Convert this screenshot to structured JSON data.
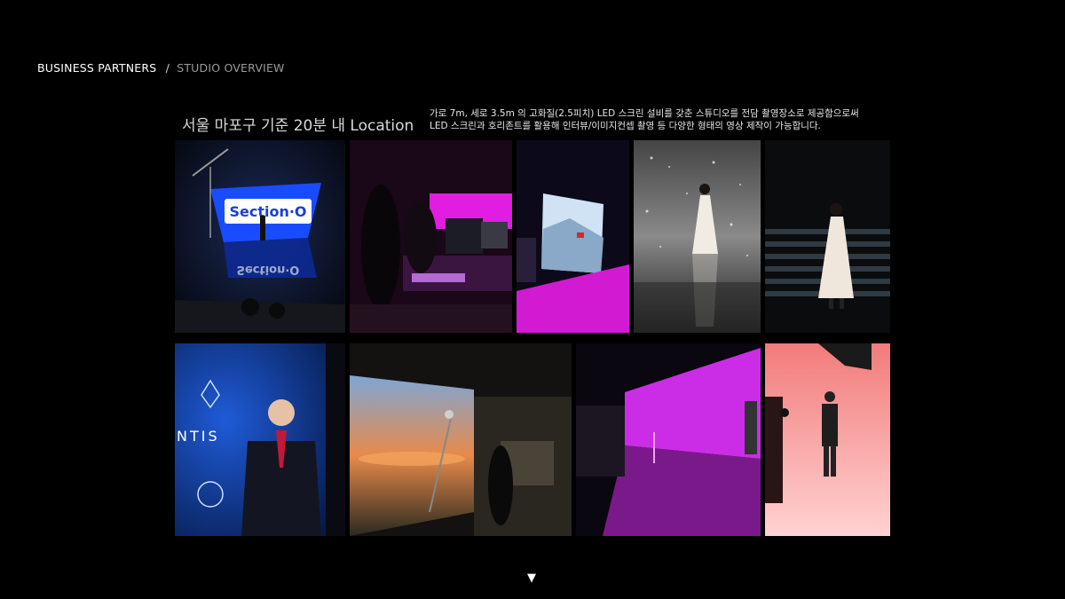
{
  "header": {
    "breadcrumb_main": "BUSINESS PARTNERS",
    "breadcrumb_sep": "/",
    "breadcrumb_sub": "STUDIO  OVERVIEW"
  },
  "headline": "서울 마포구 기준 20분 내 Location",
  "description": [
    "가로 7m, 세로 3.5m 의 고화질(2.5피치) LED 스크린 설비를 갖춘 스튜디오를 전담 촬영장소로 제공함으로써",
    "LED 스크린과 호리존트를 활용해 인터뷰/이미지컨셉 촬영 등 다양한 형태의 영상 제작이 가능합니다."
  ],
  "photos": {
    "screen_text": "Section·O",
    "screen_text_reflect": "Section·O",
    "brand_text": "NTIS"
  },
  "nav": {
    "next_icon": "▼"
  },
  "colors": {
    "background": "#000000",
    "accent_magenta": "#e020ff",
    "led_blue": "#1a4cff"
  }
}
